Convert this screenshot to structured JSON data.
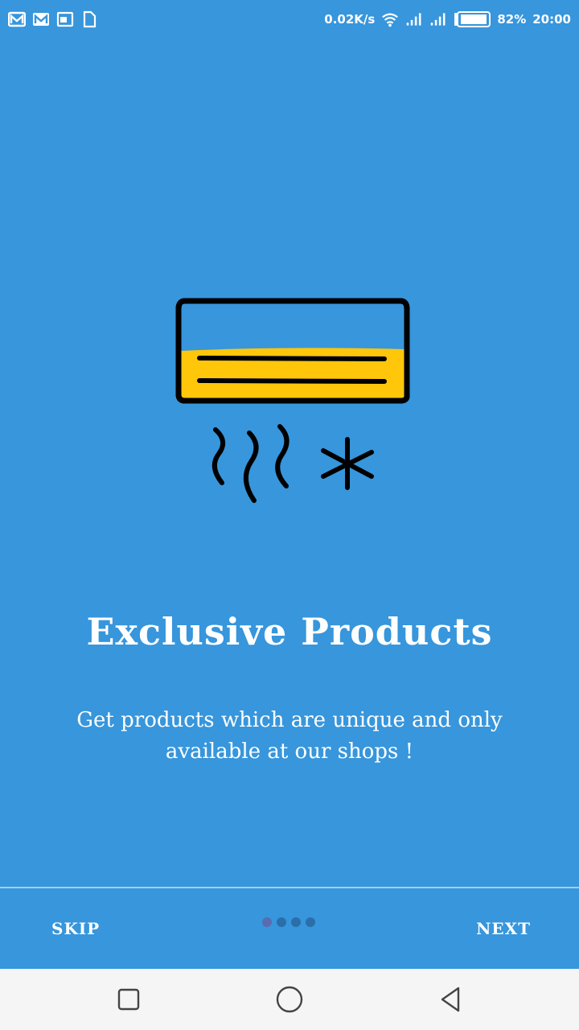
{
  "status_bar": {
    "left_icons": [
      "mail-icon",
      "gmail-icon",
      "cast-icon",
      "file-icon"
    ],
    "net_speed": "0.02K/s",
    "battery_pct": "82%",
    "time": "20:00"
  },
  "illustration": {
    "name": "air-conditioner-icon",
    "colors": {
      "fill": "#FFC60A",
      "outline": "#000000"
    }
  },
  "slide": {
    "title": "Exclusive Products",
    "subtitle": "Get products which are unique and only available at our shops !"
  },
  "controls": {
    "skip_label": "SKIP",
    "next_label": "NEXT",
    "page_count": 4,
    "current_page": 1
  },
  "colors": {
    "background": "#3796DC",
    "nav_bar": "#F5F5F5"
  }
}
